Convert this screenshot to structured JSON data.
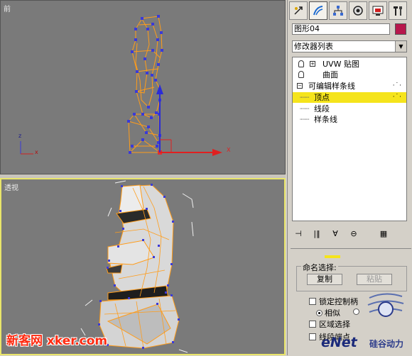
{
  "viewports": {
    "front": {
      "label": "前",
      "axis_x": "x",
      "axis_z": "z"
    },
    "perspective": {
      "label": "透视"
    }
  },
  "command_panel": {
    "tabs": [
      {
        "icon": "create-icon"
      },
      {
        "icon": "modify-icon",
        "active": true
      },
      {
        "icon": "hierarchy-icon"
      },
      {
        "icon": "motion-icon"
      },
      {
        "icon": "display-icon"
      },
      {
        "icon": "utilities-icon"
      }
    ],
    "object_name": "图形04",
    "object_color": "#b7174c",
    "modifier_list_label": "修改器列表",
    "stack": {
      "items": [
        {
          "label": "UVW 贴图"
        },
        {
          "label": "曲面"
        },
        {
          "label": "可编辑样条线"
        },
        {
          "label": "顶点",
          "selected": true
        },
        {
          "label": "线段"
        },
        {
          "label": "样条线"
        }
      ]
    },
    "rollout": {
      "named_selection_label": "命名选择:",
      "copy_button": "复制",
      "paste_button": "粘贴",
      "lock_handles_label": "锁定控制柄",
      "similar_label": "相似",
      "area_selection_label": "区域选择",
      "segment_end_label": "线段端点"
    }
  },
  "watermarks": {
    "left": "新客网 xker.com",
    "right_brand": "eNet",
    "right_sub": "硅谷动力"
  },
  "colors": {
    "viewport_bg": "#7a7a7a",
    "spline_orange": "#ff9c1a",
    "vertex_blue": "#3a3ad8",
    "selection_yellow": "#f5e41c"
  }
}
